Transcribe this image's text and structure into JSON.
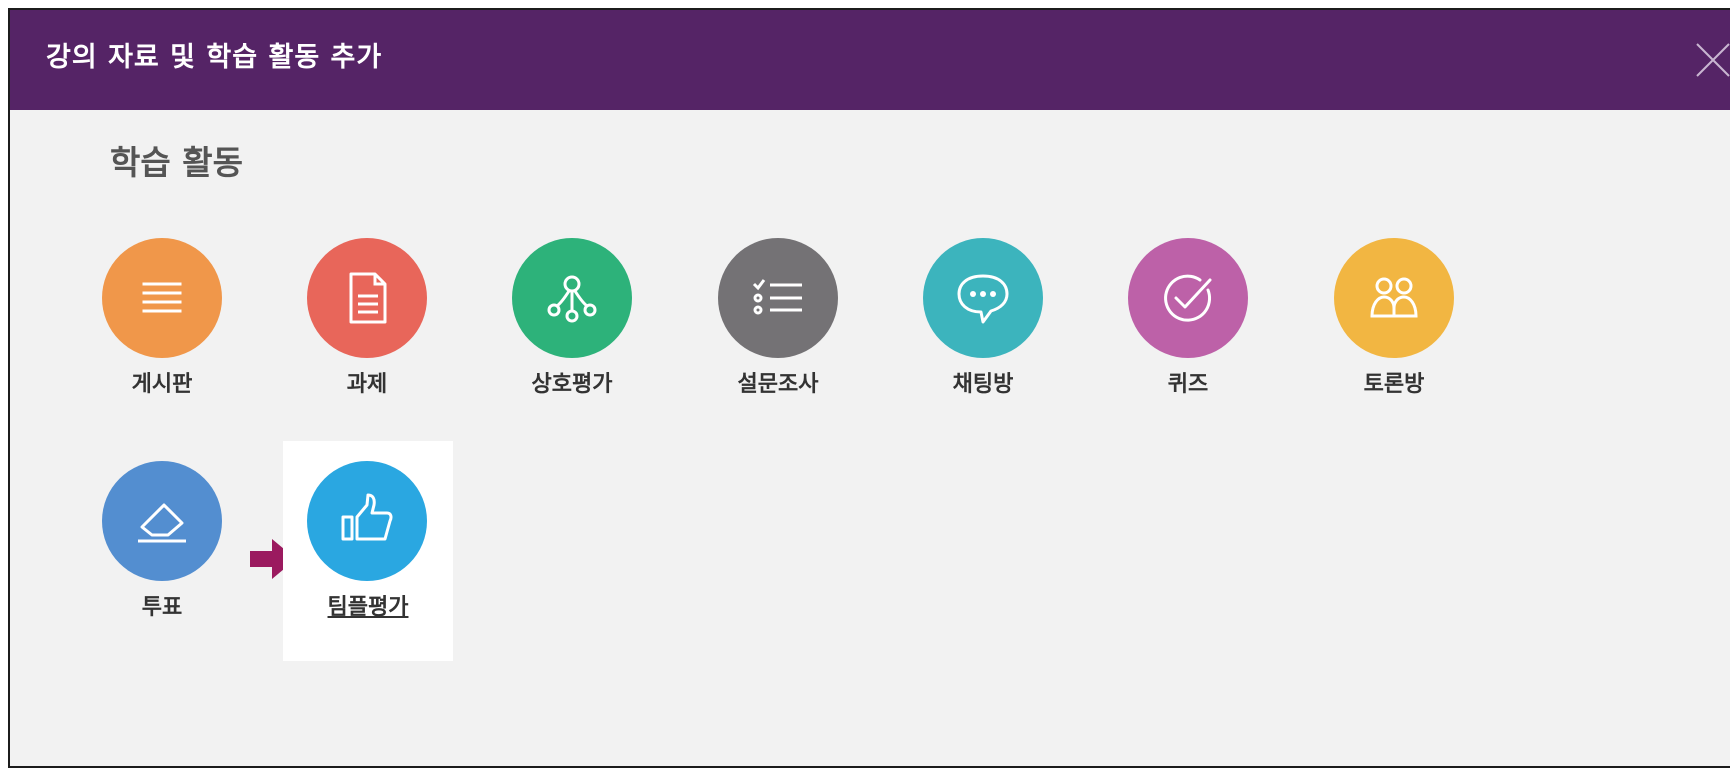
{
  "dialog": {
    "title": "강의 자료 및 학습 활동 추가",
    "close_icon": "close-icon"
  },
  "section": {
    "title": "학습 활동"
  },
  "activities": [
    {
      "id": "board",
      "label": "게시판",
      "icon": "list-lines-icon",
      "color": "#f0974a"
    },
    {
      "id": "assignment",
      "label": "과제",
      "icon": "document-icon",
      "color": "#e8665a"
    },
    {
      "id": "peer-review",
      "label": "상호평가",
      "icon": "network-icon",
      "color": "#2db27a"
    },
    {
      "id": "survey",
      "label": "설문조사",
      "icon": "checklist-icon",
      "color": "#747275"
    },
    {
      "id": "chat",
      "label": "채팅방",
      "icon": "chat-bubble-icon",
      "color": "#3cb4bd"
    },
    {
      "id": "quiz",
      "label": "퀴즈",
      "icon": "check-circle-icon",
      "color": "#bd61a8"
    },
    {
      "id": "discussion",
      "label": "토론방",
      "icon": "people-icon",
      "color": "#f2b642"
    },
    {
      "id": "vote",
      "label": "투표",
      "icon": "eraser-icon",
      "color": "#538ed0"
    },
    {
      "id": "team-review",
      "label": "팀플평가",
      "icon": "thumbs-up-icon",
      "color": "#2aa7e1",
      "highlighted": true
    }
  ],
  "indicator": {
    "icon": "arrow-right-icon",
    "color": "#9b1a5f"
  }
}
